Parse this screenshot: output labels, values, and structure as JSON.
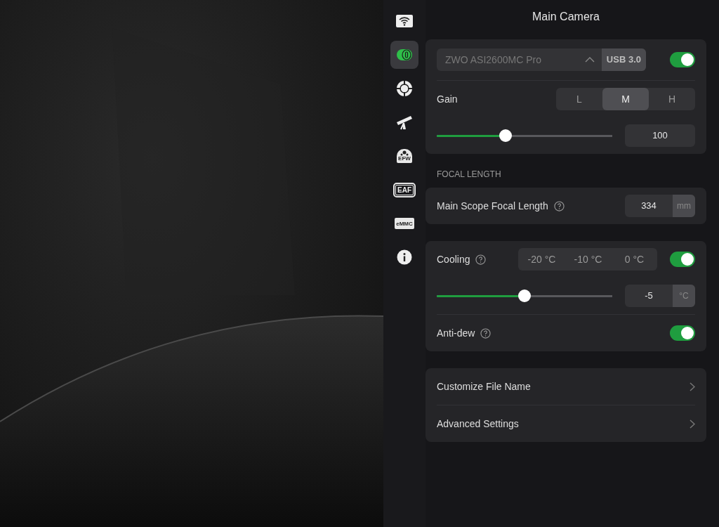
{
  "sidebar": {
    "items": [
      {
        "kind": "wifi",
        "selected": false
      },
      {
        "kind": "camera",
        "selected": true
      },
      {
        "kind": "guide",
        "selected": false
      },
      {
        "kind": "telescope",
        "selected": false
      },
      {
        "kind": "filter-wheel",
        "label": "EFW",
        "selected": false
      },
      {
        "kind": "focuser",
        "label": "EAF",
        "selected": false
      },
      {
        "kind": "storage",
        "label": "eMMC",
        "selected": false
      },
      {
        "kind": "info",
        "selected": false
      }
    ]
  },
  "panel": {
    "title": "Main Camera",
    "camera": {
      "device": "ZWO ASI2600MC Pro",
      "port": "USB 3.0",
      "on": true,
      "gain": {
        "label": "Gain",
        "options": [
          {
            "label": "L",
            "selected": false
          },
          {
            "label": "M",
            "selected": true
          },
          {
            "label": "H",
            "selected": false
          }
        ],
        "level": 0.39,
        "value": "100"
      }
    },
    "focal_length": {
      "header": "FOCAL LENGTH",
      "label": "Main Scope Focal Length",
      "value": "334",
      "unit": "mm"
    },
    "cooling": {
      "label": "Cooling",
      "presets": [
        {
          "label": "-20 °C",
          "selected": false
        },
        {
          "label": "-10 °C",
          "selected": false
        },
        {
          "label": "0 °C",
          "selected": false
        }
      ],
      "on": true,
      "level": 0.5,
      "value": "-5",
      "unit": "°C",
      "anti_dew": {
        "label": "Anti-dew",
        "on": true
      }
    },
    "links": [
      {
        "label": "Customize File Name"
      },
      {
        "label": "Advanced Settings"
      }
    ]
  }
}
